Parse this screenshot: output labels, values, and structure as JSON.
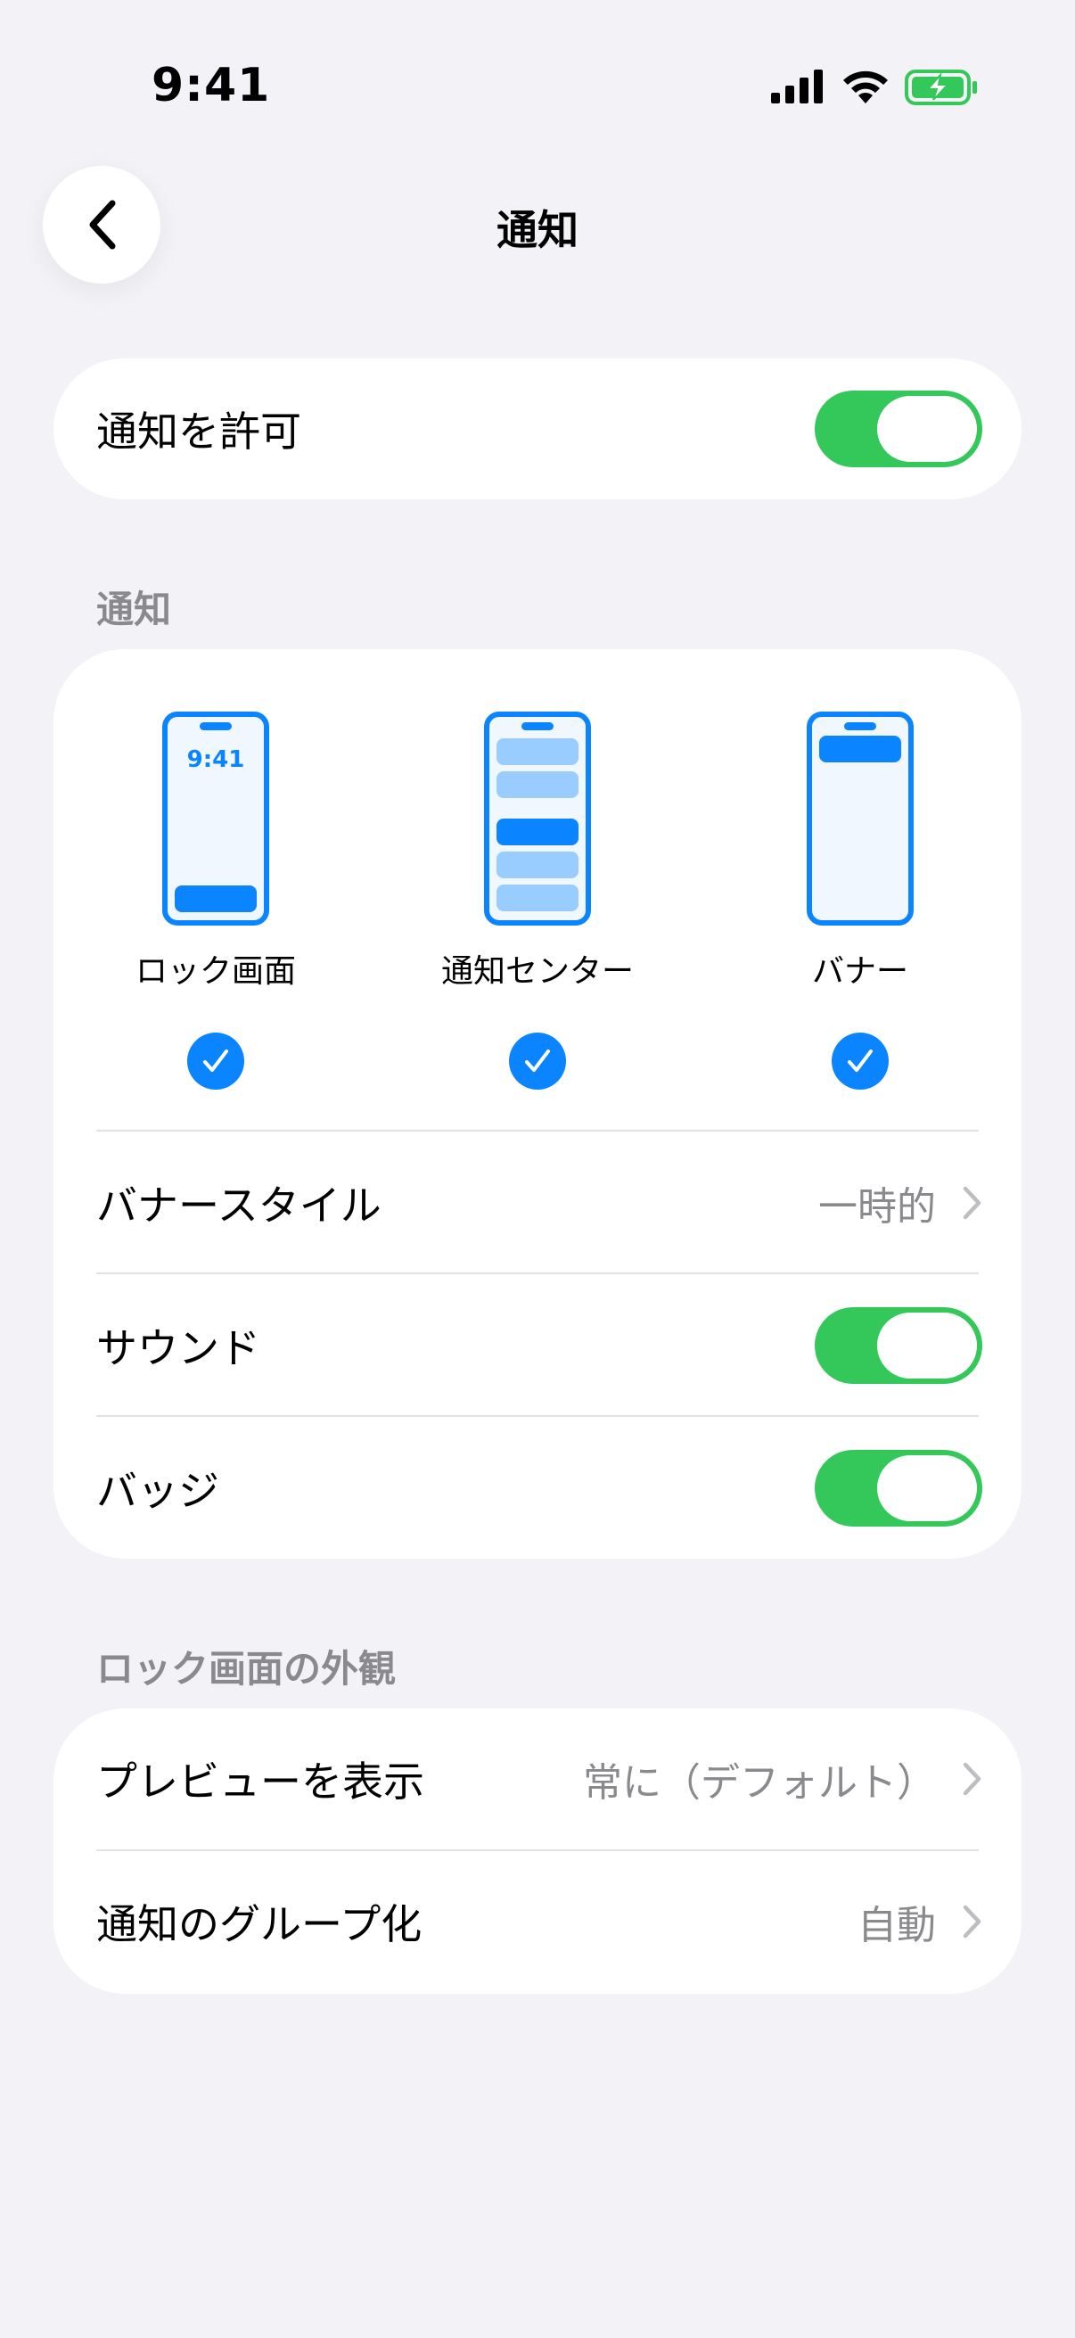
{
  "status_bar": {
    "time": "9:41"
  },
  "nav": {
    "title": "通知"
  },
  "allow": {
    "label": "通知を許可",
    "enabled": true
  },
  "notify_section": {
    "header": "通知",
    "options": [
      {
        "label": "ロック画面",
        "checked": true,
        "preview_time": "9:41"
      },
      {
        "label": "通知センター",
        "checked": true
      },
      {
        "label": "バナー",
        "checked": true
      }
    ],
    "banner_style": {
      "label": "バナースタイル",
      "value": "一時的"
    },
    "sound": {
      "label": "サウンド",
      "enabled": true
    },
    "badge": {
      "label": "バッジ",
      "enabled": true
    }
  },
  "lock_section": {
    "header": "ロック画面の外観",
    "preview": {
      "label": "プレビューを表示",
      "value": "常に（デフォルト）"
    },
    "grouping": {
      "label": "通知のグループ化",
      "value": "自動"
    }
  },
  "colors": {
    "accent": "#0A84FF",
    "toggle_on": "#34C759",
    "background": "#F2F2F7"
  }
}
